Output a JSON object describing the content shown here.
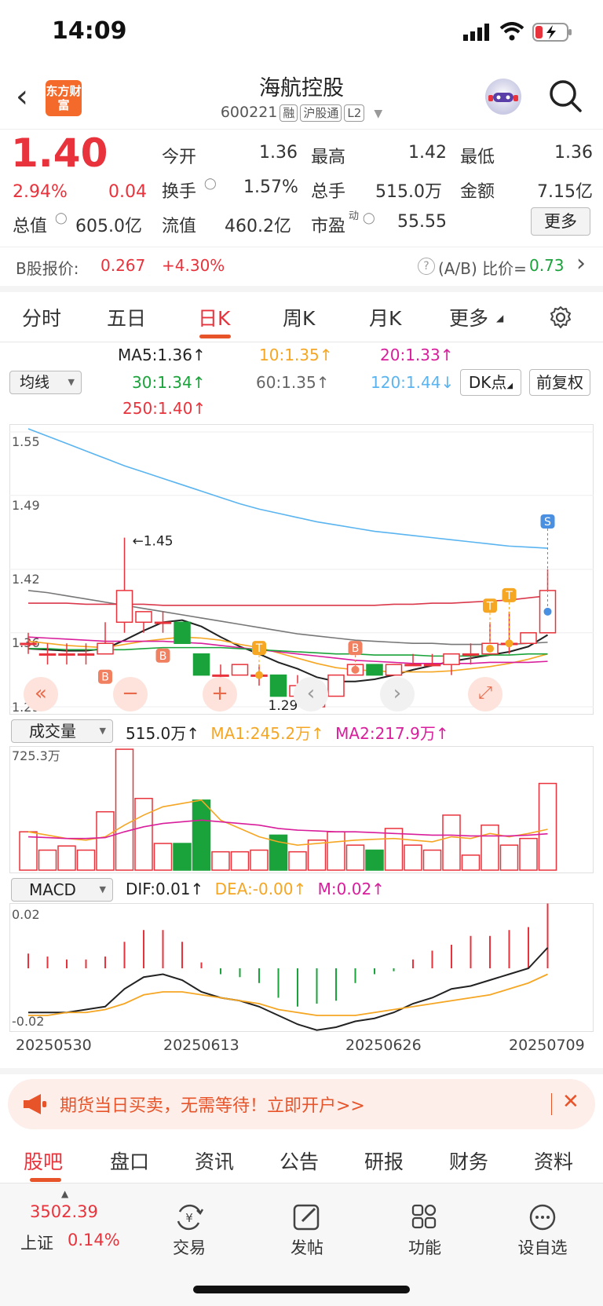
{
  "status_bar": {
    "time": "14:09"
  },
  "header": {
    "title": "海航控股",
    "code": "600221",
    "tags": [
      "融",
      "沪股通",
      "L2"
    ],
    "logo_text": "东方财富"
  },
  "quote": {
    "price": "1.40",
    "change_pct": "2.94%",
    "change": "0.04",
    "stats": [
      {
        "label": "今开",
        "value": "1.36",
        "color": "black"
      },
      {
        "label": "最高",
        "value": "1.42",
        "color": "red"
      },
      {
        "label": "最低",
        "value": "1.36",
        "color": "black"
      },
      {
        "label": "换手",
        "value": "1.57%",
        "color": "black"
      },
      {
        "label": "总手",
        "value": "515.0万",
        "color": "black"
      },
      {
        "label": "金额",
        "value": "7.15亿",
        "color": "black"
      },
      {
        "label": "总值",
        "value": "605.0亿",
        "color": "black"
      },
      {
        "label": "流值",
        "value": "460.2亿",
        "color": "black"
      },
      {
        "label": "市盈",
        "value": "55.55",
        "color": "black"
      }
    ],
    "more_button": "更多"
  },
  "b_share": {
    "label": "B股报价:",
    "price": "0.267",
    "change": "+4.30%",
    "ratio_label": "(A/B) 比价=",
    "ratio": "0.73"
  },
  "period_tabs": [
    "分时",
    "五日",
    "日K",
    "周K",
    "月K",
    "更多"
  ],
  "active_period": "日K",
  "ma_legend": {
    "selector": "均线",
    "items": [
      {
        "text": "MA5:1.36",
        "color": "#222222"
      },
      {
        "text": "10:1.35",
        "color": "#f5a623"
      },
      {
        "text": "20:1.33",
        "color": "#d81e9b"
      },
      {
        "text": "30:1.34",
        "color": "#1aa33a"
      },
      {
        "text": "60:1.35",
        "color": "#666666"
      },
      {
        "text": "120:1.44",
        "color": "#5ab4f0"
      },
      {
        "text": "250:1.40",
        "color": "#e8333c"
      }
    ],
    "dk_button": "DK点",
    "adjust_button": "前复权"
  },
  "chart_data": [
    {
      "type": "candlestick",
      "ylim": [
        1.29,
        1.55
      ],
      "y_ticks": [
        "1.55",
        "1.49",
        "1.42",
        "1.36",
        "1.29"
      ],
      "annotations": [
        {
          "text": "1.45",
          "kind": "high"
        },
        {
          "text": "1.29",
          "kind": "low"
        }
      ],
      "markers": [
        "B",
        "B",
        "T",
        "B",
        "T",
        "T",
        "S"
      ],
      "candles": [
        {
          "o": 1.35,
          "c": 1.35,
          "h": 1.36,
          "l": 1.34
        },
        {
          "o": 1.34,
          "c": 1.34,
          "h": 1.35,
          "l": 1.33
        },
        {
          "o": 1.34,
          "c": 1.34,
          "h": 1.35,
          "l": 1.33
        },
        {
          "o": 1.34,
          "c": 1.34,
          "h": 1.35,
          "l": 1.33
        },
        {
          "o": 1.34,
          "c": 1.35,
          "h": 1.37,
          "l": 1.34
        },
        {
          "o": 1.37,
          "c": 1.4,
          "h": 1.45,
          "l": 1.36
        },
        {
          "o": 1.37,
          "c": 1.38,
          "h": 1.38,
          "l": 1.36
        },
        {
          "o": 1.37,
          "c": 1.37,
          "h": 1.38,
          "l": 1.36
        },
        {
          "o": 1.37,
          "c": 1.35,
          "h": 1.37,
          "l": 1.35
        },
        {
          "o": 1.34,
          "c": 1.32,
          "h": 1.34,
          "l": 1.32
        },
        {
          "o": 1.32,
          "c": 1.32,
          "h": 1.33,
          "l": 1.31
        },
        {
          "o": 1.32,
          "c": 1.33,
          "h": 1.33,
          "l": 1.32
        },
        {
          "o": 1.32,
          "c": 1.32,
          "h": 1.33,
          "l": 1.31
        },
        {
          "o": 1.32,
          "c": 1.3,
          "h": 1.32,
          "l": 1.3
        },
        {
          "o": 1.3,
          "c": 1.31,
          "h": 1.32,
          "l": 1.3
        },
        {
          "o": 1.29,
          "c": 1.3,
          "h": 1.3,
          "l": 1.29
        },
        {
          "o": 1.3,
          "c": 1.32,
          "h": 1.32,
          "l": 1.3
        },
        {
          "o": 1.32,
          "c": 1.33,
          "h": 1.33,
          "l": 1.32
        },
        {
          "o": 1.33,
          "c": 1.32,
          "h": 1.33,
          "l": 1.32
        },
        {
          "o": 1.32,
          "c": 1.33,
          "h": 1.33,
          "l": 1.32
        },
        {
          "o": 1.33,
          "c": 1.33,
          "h": 1.34,
          "l": 1.33
        },
        {
          "o": 1.33,
          "c": 1.33,
          "h": 1.34,
          "l": 1.33
        },
        {
          "o": 1.33,
          "c": 1.34,
          "h": 1.34,
          "l": 1.32
        },
        {
          "o": 1.34,
          "c": 1.34,
          "h": 1.35,
          "l": 1.33
        },
        {
          "o": 1.34,
          "c": 1.35,
          "h": 1.37,
          "l": 1.34
        },
        {
          "o": 1.35,
          "c": 1.35,
          "h": 1.38,
          "l": 1.34
        },
        {
          "o": 1.35,
          "c": 1.36,
          "h": 1.36,
          "l": 1.35
        },
        {
          "o": 1.36,
          "c": 1.4,
          "h": 1.42,
          "l": 1.36
        }
      ],
      "ma_lines": [
        {
          "name": "MA5",
          "color": "#222222",
          "values": [
            1.345,
            1.344,
            1.343,
            1.343,
            1.345,
            1.353,
            1.362,
            1.37,
            1.372,
            1.366,
            1.356,
            1.347,
            1.34,
            1.332,
            1.326,
            1.318,
            1.314,
            1.314,
            1.316,
            1.32,
            1.325,
            1.329,
            1.333,
            1.336,
            1.339,
            1.342,
            1.347,
            1.358
          ]
        },
        {
          "name": "10",
          "color": "#f5a623",
          "values": [
            1.352,
            1.35,
            1.348,
            1.347,
            1.346,
            1.349,
            1.352,
            1.354,
            1.356,
            1.355,
            1.353,
            1.349,
            1.346,
            1.341,
            1.336,
            1.331,
            1.327,
            1.325,
            1.324,
            1.323,
            1.323,
            1.323,
            1.324,
            1.326,
            1.328,
            1.331,
            1.335,
            1.34
          ]
        },
        {
          "name": "20",
          "color": "#d81e9b",
          "values": [
            1.356,
            1.355,
            1.354,
            1.353,
            1.352,
            1.352,
            1.352,
            1.352,
            1.351,
            1.35,
            1.348,
            1.346,
            1.344,
            1.342,
            1.34,
            1.338,
            1.336,
            1.334,
            1.333,
            1.332,
            1.331,
            1.331,
            1.331,
            1.331,
            1.332,
            1.332,
            1.332,
            1.333
          ]
        },
        {
          "name": "30",
          "color": "#1aa33a",
          "values": [
            1.345,
            1.345,
            1.344,
            1.344,
            1.344,
            1.344,
            1.345,
            1.346,
            1.346,
            1.346,
            1.346,
            1.345,
            1.344,
            1.343,
            1.342,
            1.341,
            1.34,
            1.34,
            1.339,
            1.339,
            1.339,
            1.338,
            1.338,
            1.338,
            1.339,
            1.339,
            1.34,
            1.34
          ]
        },
        {
          "name": "60",
          "color": "#777777",
          "values": [
            1.4,
            1.398,
            1.395,
            1.392,
            1.389,
            1.386,
            1.383,
            1.38,
            1.377,
            1.374,
            1.371,
            1.368,
            1.365,
            1.362,
            1.359,
            1.357,
            1.355,
            1.353,
            1.352,
            1.351,
            1.35,
            1.35,
            1.349,
            1.349,
            1.349,
            1.349,
            1.35,
            1.351
          ]
        },
        {
          "name": "120",
          "color": "#5ab4f0",
          "values": [
            1.553,
            1.546,
            1.539,
            1.532,
            1.525,
            1.518,
            1.512,
            1.506,
            1.5,
            1.494,
            1.488,
            1.482,
            1.477,
            1.473,
            1.469,
            1.465,
            1.462,
            1.459,
            1.456,
            1.454,
            1.452,
            1.45,
            1.448,
            1.446,
            1.444,
            1.442,
            1.441,
            1.44
          ]
        },
        {
          "name": "250",
          "color": "#d9394b",
          "values": [
            1.388,
            1.388,
            1.388,
            1.387,
            1.387,
            1.387,
            1.387,
            1.386,
            1.386,
            1.386,
            1.386,
            1.386,
            1.386,
            1.386,
            1.386,
            1.386,
            1.386,
            1.386,
            1.386,
            1.387,
            1.387,
            1.388,
            1.388,
            1.389,
            1.39,
            1.391,
            1.393,
            1.395
          ]
        }
      ]
    },
    {
      "type": "bar",
      "title": "成交量",
      "ylim": [
        0,
        725.3
      ],
      "y_ticks": [
        "725.3万"
      ],
      "legend": [
        {
          "text": "515.0万",
          "color": "#222222"
        },
        {
          "text": "MA1:245.2万",
          "color": "#f5a623"
        },
        {
          "text": "MA2:217.9万",
          "color": "#d81e9b"
        }
      ],
      "values": [
        230,
        120,
        145,
        120,
        350,
        725,
        430,
        160,
        160,
        420,
        110,
        110,
        120,
        210,
        110,
        180,
        230,
        150,
        120,
        250,
        150,
        120,
        330,
        90,
        270,
        150,
        190,
        520
      ],
      "ma1": [
        230,
        210,
        190,
        180,
        200,
        270,
        330,
        380,
        400,
        420,
        300,
        250,
        200,
        170,
        150,
        160,
        170,
        180,
        185,
        190,
        180,
        170,
        200,
        190,
        220,
        200,
        220,
        245
      ],
      "ma2": [
        200,
        195,
        190,
        190,
        195,
        230,
        260,
        280,
        290,
        300,
        290,
        280,
        270,
        250,
        240,
        235,
        230,
        230,
        225,
        220,
        215,
        210,
        210,
        205,
        205,
        205,
        210,
        218
      ]
    },
    {
      "type": "bar",
      "title": "MACD",
      "ylim": [
        -0.02,
        0.02
      ],
      "y_ticks": [
        "0.02",
        "-0.02"
      ],
      "legend": [
        {
          "text": "DIF:0.01",
          "color": "#222222"
        },
        {
          "text": "DEA:-0.00",
          "color": "#f5a623"
        },
        {
          "text": "M:0.02",
          "color": "#d81e9b"
        }
      ],
      "x_ticks": [
        "20250530",
        "20250613",
        "20250626",
        "20250709"
      ],
      "hist": [
        0.005,
        0.004,
        0.003,
        0.003,
        0.004,
        0.009,
        0.013,
        0.013,
        0.009,
        0.002,
        -0.002,
        -0.003,
        -0.005,
        -0.01,
        -0.013,
        -0.012,
        -0.011,
        -0.005,
        -0.002,
        -0.001,
        0.003,
        0.006,
        0.008,
        0.011,
        0.011,
        0.013,
        0.014,
        0.022
      ],
      "dif": [
        -0.015,
        -0.015,
        -0.015,
        -0.014,
        -0.013,
        -0.007,
        -0.003,
        -0.002,
        -0.004,
        -0.008,
        -0.01,
        -0.011,
        -0.013,
        -0.016,
        -0.019,
        -0.021,
        -0.02,
        -0.018,
        -0.017,
        -0.015,
        -0.012,
        -0.01,
        -0.007,
        -0.006,
        -0.004,
        -0.002,
        0.0,
        0.007
      ],
      "dea": [
        -0.016,
        -0.016,
        -0.015,
        -0.015,
        -0.014,
        -0.012,
        -0.009,
        -0.008,
        -0.008,
        -0.009,
        -0.01,
        -0.011,
        -0.012,
        -0.014,
        -0.015,
        -0.016,
        -0.016,
        -0.016,
        -0.015,
        -0.014,
        -0.013,
        -0.012,
        -0.011,
        -0.01,
        -0.009,
        -0.007,
        -0.005,
        -0.002
      ]
    }
  ],
  "volume_selector": "成交量",
  "macd_selector": "MACD",
  "banner": {
    "text": "期货当日买卖，无需等待！立即开户>>"
  },
  "bottom_tabs": [
    "股吧",
    "盘口",
    "资讯",
    "公告",
    "研报",
    "财务",
    "资料"
  ],
  "active_bottom_tab": "股吧",
  "index": {
    "value": "3502.39",
    "name": "上证",
    "change": "0.14%"
  },
  "toolbar": [
    {
      "label": "交易",
      "icon": "trade-icon"
    },
    {
      "label": "发帖",
      "icon": "post-icon"
    },
    {
      "label": "功能",
      "icon": "function-icon"
    },
    {
      "label": "设自选",
      "icon": "add-watchlist-icon"
    }
  ]
}
